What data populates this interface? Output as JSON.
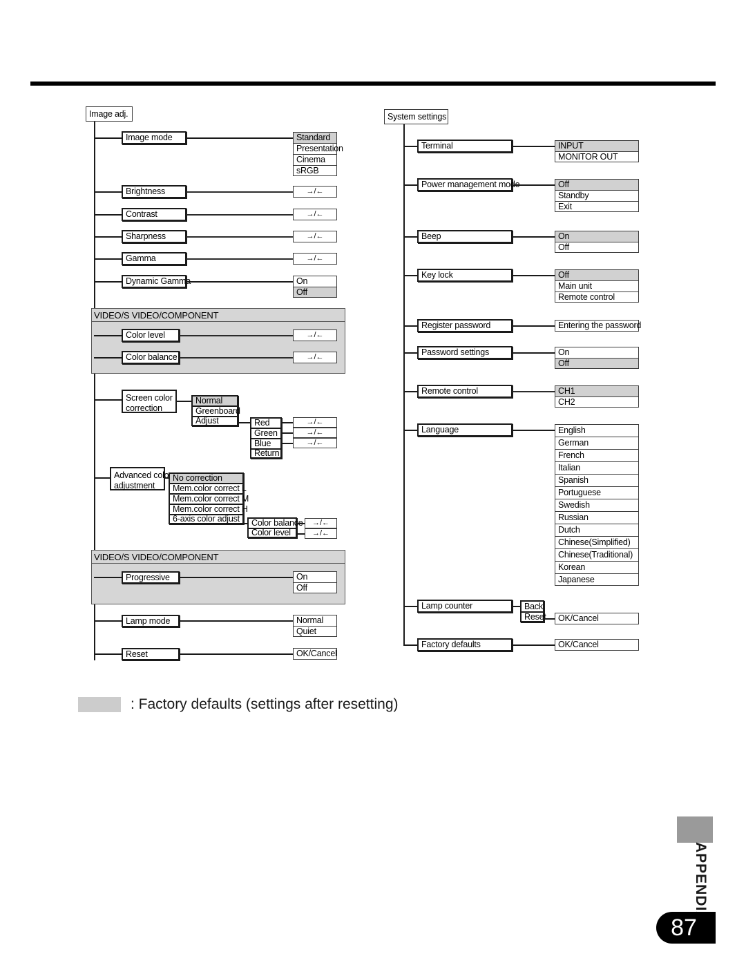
{
  "page": {
    "number": "87",
    "section_label": "APPENDIX"
  },
  "legend": {
    "separator": ":",
    "text": ": Factory defaults (settings after resetting)",
    "swatch_color": "#cccccc"
  },
  "colors": {
    "highlight_gray": "#d1d1d1",
    "panel_gray": "#d6d6d6",
    "line": "#1a1a1a"
  },
  "tokens": {
    "adjust_arrows": "→/←"
  },
  "image_adj": {
    "root": "Image adj.",
    "items": {
      "image_mode": "Image mode",
      "brightness": "Brightness",
      "contrast": "Contrast",
      "sharpness": "Sharpness",
      "gamma": "Gamma",
      "dynamic_gamma": "Dynamic Gamma",
      "color_level": "Color level",
      "color_balance": "Color balance",
      "screen_color_correction_l1": "Screen color",
      "screen_color_correction_l2": "correction",
      "advanced_color_adjustment_l1": "Advanced color",
      "advanced_color_adjustment_l2": "adjustment",
      "progressive": "Progressive",
      "lamp_mode": "Lamp mode",
      "reset": "Reset"
    },
    "image_mode_options": [
      {
        "label": "Standard",
        "default": true
      },
      {
        "label": "Presentation",
        "default": false
      },
      {
        "label": "Cinema",
        "default": false
      },
      {
        "label": "sRGB",
        "default": false
      }
    ],
    "dynamic_gamma_options": [
      {
        "label": "On",
        "default": false
      },
      {
        "label": "Off",
        "default": true
      }
    ],
    "screen_color_options": [
      {
        "label": "Normal",
        "default": true
      },
      {
        "label": "Greenboard",
        "default": false
      },
      {
        "label": "Adjust",
        "default": false
      }
    ],
    "screen_color_adjust_options": [
      {
        "label": "Red",
        "default": false
      },
      {
        "label": "Green",
        "default": false
      },
      {
        "label": "Blue",
        "default": false
      },
      {
        "label": "Return",
        "default": false
      }
    ],
    "advanced_color_options": [
      {
        "label": "No correction",
        "default": true
      },
      {
        "label": "Mem.color correct L",
        "default": false
      },
      {
        "label": "Mem.color correct M",
        "default": false
      },
      {
        "label": "Mem.color correct H",
        "default": false
      },
      {
        "label": "6-axis color adjust",
        "default": false
      }
    ],
    "six_axis_options": [
      {
        "label": "Color balance",
        "default": false
      },
      {
        "label": "Color level",
        "default": false
      }
    ],
    "progressive_options": [
      {
        "label": "On",
        "default": false
      },
      {
        "label": "Off",
        "default": false
      }
    ],
    "lamp_mode_options": [
      {
        "label": "Normal",
        "default": false
      },
      {
        "label": "Quiet",
        "default": false
      }
    ],
    "reset_options": [
      {
        "label": "OK/Cancel",
        "default": false
      }
    ],
    "video_panel_title_1": "VIDEO/S VIDEO/COMPONENT",
    "video_panel_title_2": "VIDEO/S VIDEO/COMPONENT"
  },
  "system_settings": {
    "root": "System settings",
    "items": {
      "terminal": "Terminal",
      "power_management_mode": "Power management mode",
      "beep": "Beep",
      "key_lock": "Key lock",
      "register_password": "Register password",
      "password_settings": "Password settings",
      "remote_control": "Remote control",
      "language": "Language",
      "lamp_counter": "Lamp counter",
      "factory_defaults": "Factory defaults"
    },
    "terminal_options": [
      {
        "label": "INPUT",
        "default": true
      },
      {
        "label": "MONITOR OUT",
        "default": false
      }
    ],
    "power_management_options": [
      {
        "label": "Off",
        "default": true
      },
      {
        "label": "Standby",
        "default": false
      },
      {
        "label": "Exit",
        "default": false
      }
    ],
    "beep_options": [
      {
        "label": "On",
        "default": true
      },
      {
        "label": "Off",
        "default": false
      }
    ],
    "key_lock_options": [
      {
        "label": "Off",
        "default": true
      },
      {
        "label": "Main unit",
        "default": false
      },
      {
        "label": "Remote control",
        "default": false
      }
    ],
    "register_password_options": [
      {
        "label": "Entering the password",
        "default": false
      }
    ],
    "password_settings_options": [
      {
        "label": "On",
        "default": false
      },
      {
        "label": "Off",
        "default": true
      }
    ],
    "remote_control_options": [
      {
        "label": "CH1",
        "default": true
      },
      {
        "label": "CH2",
        "default": false
      }
    ],
    "language_options": [
      {
        "label": "English",
        "default": false
      },
      {
        "label": "German",
        "default": false
      },
      {
        "label": "French",
        "default": false
      },
      {
        "label": "Italian",
        "default": false
      },
      {
        "label": "Spanish",
        "default": false
      },
      {
        "label": "Portuguese",
        "default": false
      },
      {
        "label": "Swedish",
        "default": false
      },
      {
        "label": "Russian",
        "default": false
      },
      {
        "label": "Dutch",
        "default": false
      },
      {
        "label": "Chinese(Simplified)",
        "default": false
      },
      {
        "label": "Chinese(Traditional)",
        "default": false
      },
      {
        "label": "Korean",
        "default": false
      },
      {
        "label": "Japanese",
        "default": false
      }
    ],
    "lamp_counter_options": [
      {
        "label": "Back",
        "default": false
      },
      {
        "label": "Reset",
        "default": false
      }
    ],
    "lamp_counter_reset_confirm": "OK/Cancel",
    "factory_defaults_options": [
      {
        "label": "OK/Cancel",
        "default": false
      }
    ]
  }
}
